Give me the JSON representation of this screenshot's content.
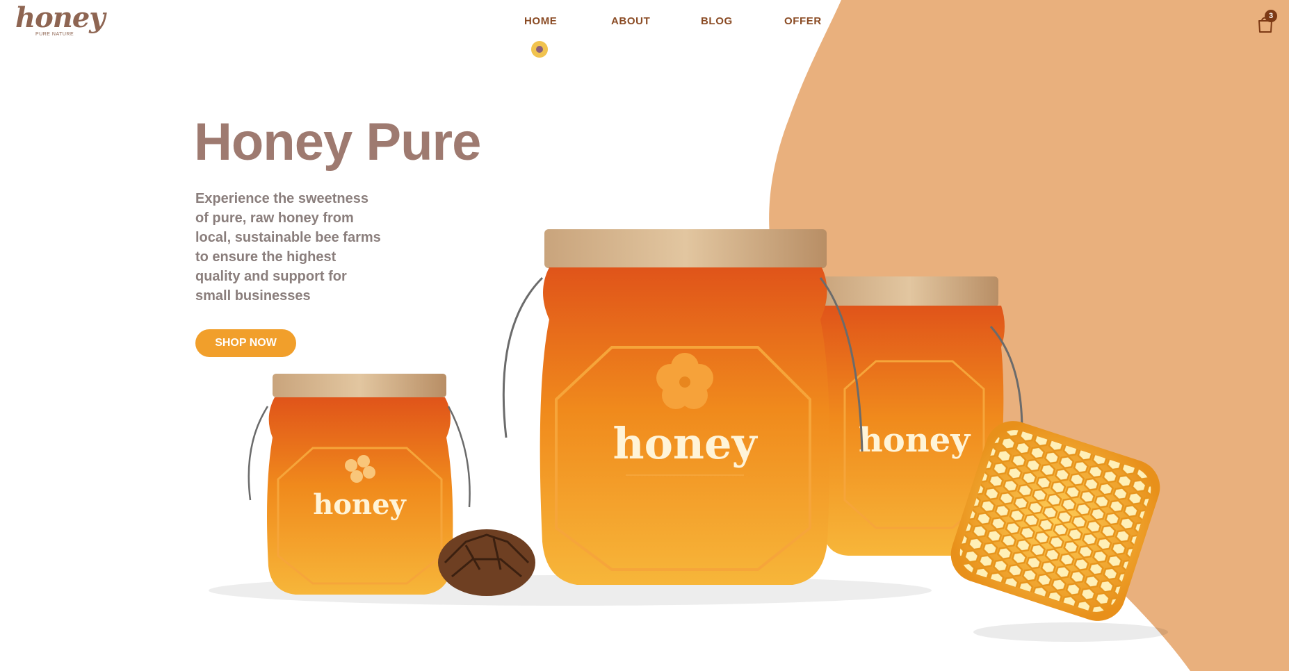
{
  "brand": {
    "logo_word": "honey",
    "logo_tagline": "PURE NATURE"
  },
  "nav": {
    "items": [
      "HOME",
      "ABOUT",
      "BLOG",
      "OFFER"
    ],
    "active": "HOME"
  },
  "cart": {
    "count": "3"
  },
  "hero": {
    "title": "Honey Pure",
    "description": "Experience the sweetness of pure, raw honey from local, sustainable bee farms to ensure the highest quality and support for small businesses",
    "cta_label": "SHOP NOW"
  },
  "jars": {
    "label_text": "honey"
  },
  "colors": {
    "accent": "#f19f2b",
    "blob": "#e9b07d",
    "brand_brown": "#8e6552",
    "nav_text": "#8a4b24",
    "title": "#9e7a70"
  },
  "icons": [
    "flower-icon",
    "shopping-bag-icon"
  ]
}
